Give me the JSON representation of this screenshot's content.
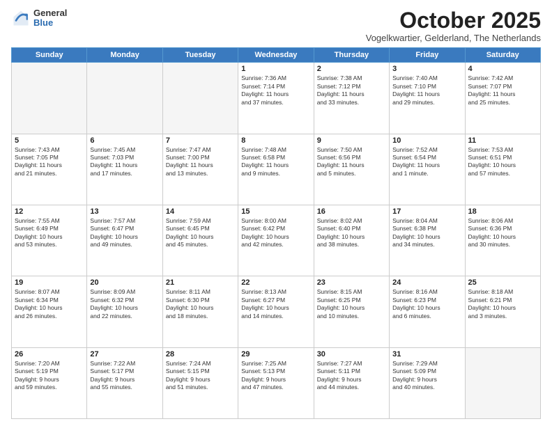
{
  "logo": {
    "general": "General",
    "blue": "Blue"
  },
  "header": {
    "month": "October 2025",
    "location": "Vogelkwartier, Gelderland, The Netherlands"
  },
  "weekdays": [
    "Sunday",
    "Monday",
    "Tuesday",
    "Wednesday",
    "Thursday",
    "Friday",
    "Saturday"
  ],
  "weeks": [
    [
      {
        "day": "",
        "info": "",
        "empty": true
      },
      {
        "day": "",
        "info": "",
        "empty": true
      },
      {
        "day": "",
        "info": "",
        "empty": true
      },
      {
        "day": "1",
        "info": "Sunrise: 7:36 AM\nSunset: 7:14 PM\nDaylight: 11 hours\nand 37 minutes.",
        "empty": false
      },
      {
        "day": "2",
        "info": "Sunrise: 7:38 AM\nSunset: 7:12 PM\nDaylight: 11 hours\nand 33 minutes.",
        "empty": false
      },
      {
        "day": "3",
        "info": "Sunrise: 7:40 AM\nSunset: 7:10 PM\nDaylight: 11 hours\nand 29 minutes.",
        "empty": false
      },
      {
        "day": "4",
        "info": "Sunrise: 7:42 AM\nSunset: 7:07 PM\nDaylight: 11 hours\nand 25 minutes.",
        "empty": false
      }
    ],
    [
      {
        "day": "5",
        "info": "Sunrise: 7:43 AM\nSunset: 7:05 PM\nDaylight: 11 hours\nand 21 minutes.",
        "empty": false
      },
      {
        "day": "6",
        "info": "Sunrise: 7:45 AM\nSunset: 7:03 PM\nDaylight: 11 hours\nand 17 minutes.",
        "empty": false
      },
      {
        "day": "7",
        "info": "Sunrise: 7:47 AM\nSunset: 7:00 PM\nDaylight: 11 hours\nand 13 minutes.",
        "empty": false
      },
      {
        "day": "8",
        "info": "Sunrise: 7:48 AM\nSunset: 6:58 PM\nDaylight: 11 hours\nand 9 minutes.",
        "empty": false
      },
      {
        "day": "9",
        "info": "Sunrise: 7:50 AM\nSunset: 6:56 PM\nDaylight: 11 hours\nand 5 minutes.",
        "empty": false
      },
      {
        "day": "10",
        "info": "Sunrise: 7:52 AM\nSunset: 6:54 PM\nDaylight: 11 hours\nand 1 minute.",
        "empty": false
      },
      {
        "day": "11",
        "info": "Sunrise: 7:53 AM\nSunset: 6:51 PM\nDaylight: 10 hours\nand 57 minutes.",
        "empty": false
      }
    ],
    [
      {
        "day": "12",
        "info": "Sunrise: 7:55 AM\nSunset: 6:49 PM\nDaylight: 10 hours\nand 53 minutes.",
        "empty": false
      },
      {
        "day": "13",
        "info": "Sunrise: 7:57 AM\nSunset: 6:47 PM\nDaylight: 10 hours\nand 49 minutes.",
        "empty": false
      },
      {
        "day": "14",
        "info": "Sunrise: 7:59 AM\nSunset: 6:45 PM\nDaylight: 10 hours\nand 45 minutes.",
        "empty": false
      },
      {
        "day": "15",
        "info": "Sunrise: 8:00 AM\nSunset: 6:42 PM\nDaylight: 10 hours\nand 42 minutes.",
        "empty": false
      },
      {
        "day": "16",
        "info": "Sunrise: 8:02 AM\nSunset: 6:40 PM\nDaylight: 10 hours\nand 38 minutes.",
        "empty": false
      },
      {
        "day": "17",
        "info": "Sunrise: 8:04 AM\nSunset: 6:38 PM\nDaylight: 10 hours\nand 34 minutes.",
        "empty": false
      },
      {
        "day": "18",
        "info": "Sunrise: 8:06 AM\nSunset: 6:36 PM\nDaylight: 10 hours\nand 30 minutes.",
        "empty": false
      }
    ],
    [
      {
        "day": "19",
        "info": "Sunrise: 8:07 AM\nSunset: 6:34 PM\nDaylight: 10 hours\nand 26 minutes.",
        "empty": false
      },
      {
        "day": "20",
        "info": "Sunrise: 8:09 AM\nSunset: 6:32 PM\nDaylight: 10 hours\nand 22 minutes.",
        "empty": false
      },
      {
        "day": "21",
        "info": "Sunrise: 8:11 AM\nSunset: 6:30 PM\nDaylight: 10 hours\nand 18 minutes.",
        "empty": false
      },
      {
        "day": "22",
        "info": "Sunrise: 8:13 AM\nSunset: 6:27 PM\nDaylight: 10 hours\nand 14 minutes.",
        "empty": false
      },
      {
        "day": "23",
        "info": "Sunrise: 8:15 AM\nSunset: 6:25 PM\nDaylight: 10 hours\nand 10 minutes.",
        "empty": false
      },
      {
        "day": "24",
        "info": "Sunrise: 8:16 AM\nSunset: 6:23 PM\nDaylight: 10 hours\nand 6 minutes.",
        "empty": false
      },
      {
        "day": "25",
        "info": "Sunrise: 8:18 AM\nSunset: 6:21 PM\nDaylight: 10 hours\nand 3 minutes.",
        "empty": false
      }
    ],
    [
      {
        "day": "26",
        "info": "Sunrise: 7:20 AM\nSunset: 5:19 PM\nDaylight: 9 hours\nand 59 minutes.",
        "empty": false
      },
      {
        "day": "27",
        "info": "Sunrise: 7:22 AM\nSunset: 5:17 PM\nDaylight: 9 hours\nand 55 minutes.",
        "empty": false
      },
      {
        "day": "28",
        "info": "Sunrise: 7:24 AM\nSunset: 5:15 PM\nDaylight: 9 hours\nand 51 minutes.",
        "empty": false
      },
      {
        "day": "29",
        "info": "Sunrise: 7:25 AM\nSunset: 5:13 PM\nDaylight: 9 hours\nand 47 minutes.",
        "empty": false
      },
      {
        "day": "30",
        "info": "Sunrise: 7:27 AM\nSunset: 5:11 PM\nDaylight: 9 hours\nand 44 minutes.",
        "empty": false
      },
      {
        "day": "31",
        "info": "Sunrise: 7:29 AM\nSunset: 5:09 PM\nDaylight: 9 hours\nand 40 minutes.",
        "empty": false
      },
      {
        "day": "",
        "info": "",
        "empty": true
      }
    ]
  ]
}
